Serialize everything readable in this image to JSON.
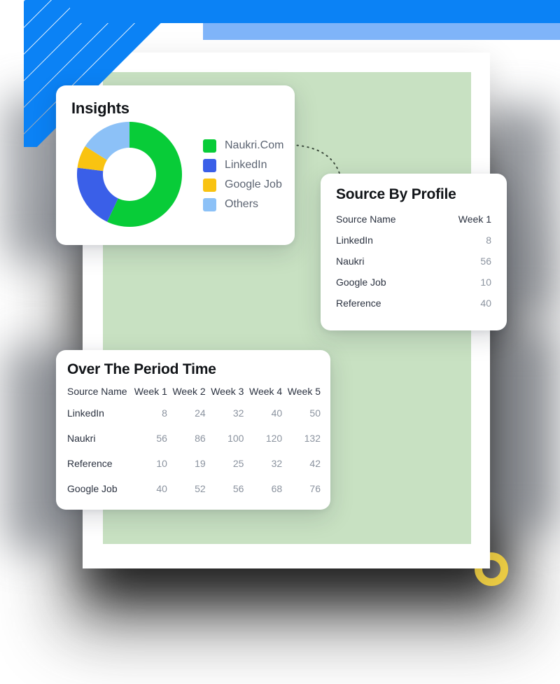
{
  "decor": {
    "bar_dark_color": "#0b82f5",
    "bar_light_color": "#7fb4f9",
    "stripe_color": "#0b82f5",
    "ring_color": "#efcf45",
    "frame_panel_color": "#c8e1c2",
    "connector_color": "#3f4d3f"
  },
  "insights": {
    "title": "Insights",
    "legend": [
      {
        "label": "Naukri.Com",
        "color": "#08cc38"
      },
      {
        "label": "LinkedIn",
        "color": "#3a5fe8"
      },
      {
        "label": "Google Job",
        "color": "#f9c311"
      },
      {
        "label": "Others",
        "color": "#8cc1f7"
      }
    ]
  },
  "chart_data": {
    "type": "pie",
    "title": "Insights",
    "subtitle": "",
    "variant": "donut",
    "categories": [
      "Naukri.Com",
      "LinkedIn",
      "Google Job",
      "Others"
    ],
    "values": [
      57,
      20,
      7,
      16
    ],
    "unit": "percent",
    "colors": [
      "#08cc38",
      "#3a5fe8",
      "#f9c311",
      "#8cc1f7"
    ],
    "legend_position": "right",
    "grid": false,
    "xlabel": "",
    "ylabel": ""
  },
  "source_by_profile": {
    "title": "Source By Profile",
    "columns": [
      "Source Name",
      "Week 1"
    ],
    "rows": [
      {
        "name": "LinkedIn",
        "values": [
          "8"
        ]
      },
      {
        "name": "Naukri",
        "values": [
          "56"
        ]
      },
      {
        "name": "Google Job",
        "values": [
          "10"
        ]
      },
      {
        "name": "Reference",
        "values": [
          "40"
        ]
      }
    ]
  },
  "over_the_period_time": {
    "title": "Over The Period Time",
    "columns": [
      "Source Name",
      "Week 1",
      "Week 2",
      "Week 3",
      "Week 4",
      "Week 5"
    ],
    "rows": [
      {
        "name": "LinkedIn",
        "values": [
          "8",
          "24",
          "32",
          "40",
          "50"
        ]
      },
      {
        "name": "Naukri",
        "values": [
          "56",
          "86",
          "100",
          "120",
          "132"
        ]
      },
      {
        "name": "Reference",
        "values": [
          "10",
          "19",
          "25",
          "32",
          "42"
        ]
      },
      {
        "name": "Google Job",
        "values": [
          "40",
          "52",
          "56",
          "68",
          "76"
        ]
      }
    ]
  }
}
